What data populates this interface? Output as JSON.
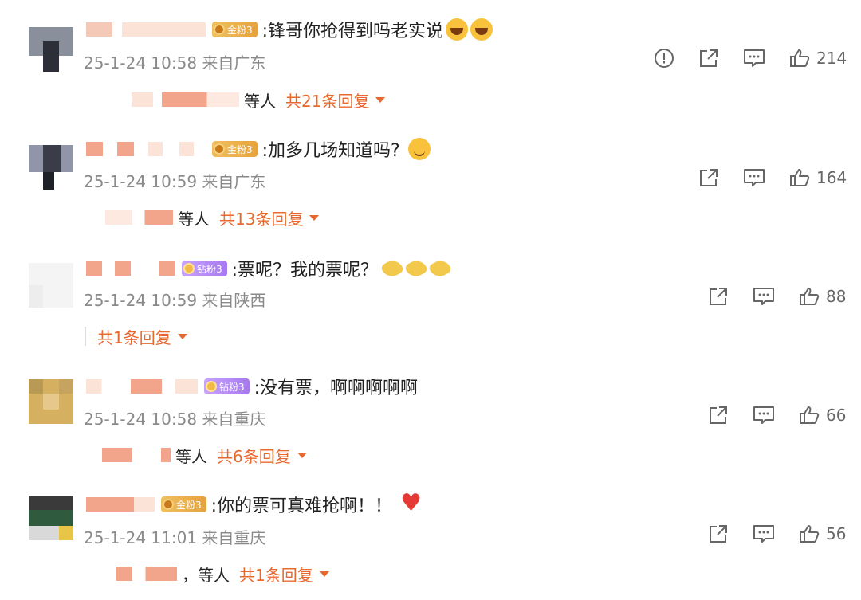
{
  "comments": [
    {
      "badge": "金粉3",
      "text": ":锋哥你抢得到吗老实说",
      "meta": "25-1-24 10:58 来自广东",
      "likes": "214",
      "reply_tail": "等人",
      "reply_count": "共21条回复",
      "has_report": true
    },
    {
      "badge": "金粉3",
      "text": ":加多几场知道吗?",
      "meta": "25-1-24 10:59 来自广东",
      "likes": "164",
      "reply_tail": "等人",
      "reply_count": "共13条回复",
      "has_report": false
    },
    {
      "badge": "钻粉3",
      "text": ":票呢？我的票呢？",
      "meta": "25-1-24 10:59 来自陕西",
      "likes": "88",
      "reply_tail": "",
      "reply_count": "共1条回复",
      "has_report": false
    },
    {
      "badge": "钻粉3",
      "text": ":没有票，啊啊啊啊啊",
      "meta": "25-1-24 10:58 来自重庆",
      "likes": "66",
      "reply_tail": "等人",
      "reply_count": "共6条回复",
      "has_report": false
    },
    {
      "badge": "金粉3",
      "text": ":你的票可真难抢啊！！",
      "meta": "25-1-24 11:01 来自重庆",
      "likes": "56",
      "reply_tail": "，等人",
      "reply_count": "共1条回复",
      "has_report": false
    }
  ],
  "icons": {
    "report": "report-icon",
    "share": "share-icon",
    "comment": "comment-icon",
    "like": "like-icon"
  },
  "colors": {
    "accent": "#e8692f",
    "meta": "#8a8a8a",
    "badge_gold": "#e6a23c",
    "badge_diamond": "#a678f0"
  }
}
